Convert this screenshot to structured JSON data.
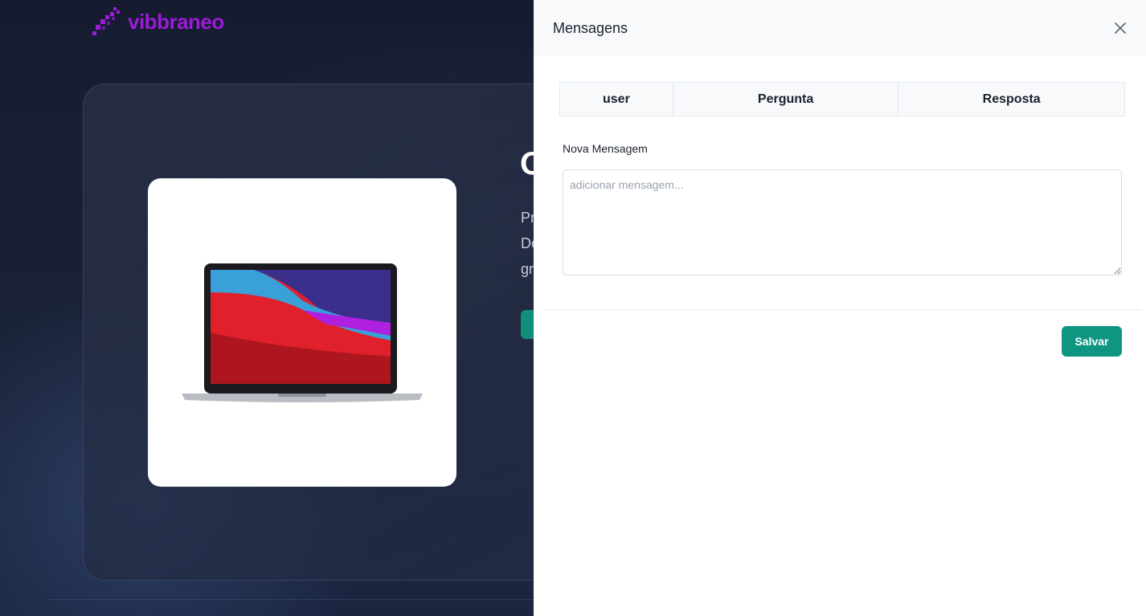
{
  "background": {
    "logo_text": "vibbraneo",
    "hero_title_clip": "O",
    "hero_text_lines": [
      "Pr",
      "De",
      "gr"
    ]
  },
  "drawer": {
    "title": "Mensagens",
    "close_icon": "close-icon",
    "table": {
      "headers": [
        "user",
        "Pergunta",
        "Resposta"
      ],
      "rows": []
    },
    "new_message_label": "Nova Mensagem",
    "textarea_placeholder": "adicionar mensagem...",
    "textarea_value": "",
    "save_label": "Salvar"
  },
  "colors": {
    "brand": "#9b1bd6",
    "accent": "#0f9682",
    "page_bg": "#141a2c"
  }
}
